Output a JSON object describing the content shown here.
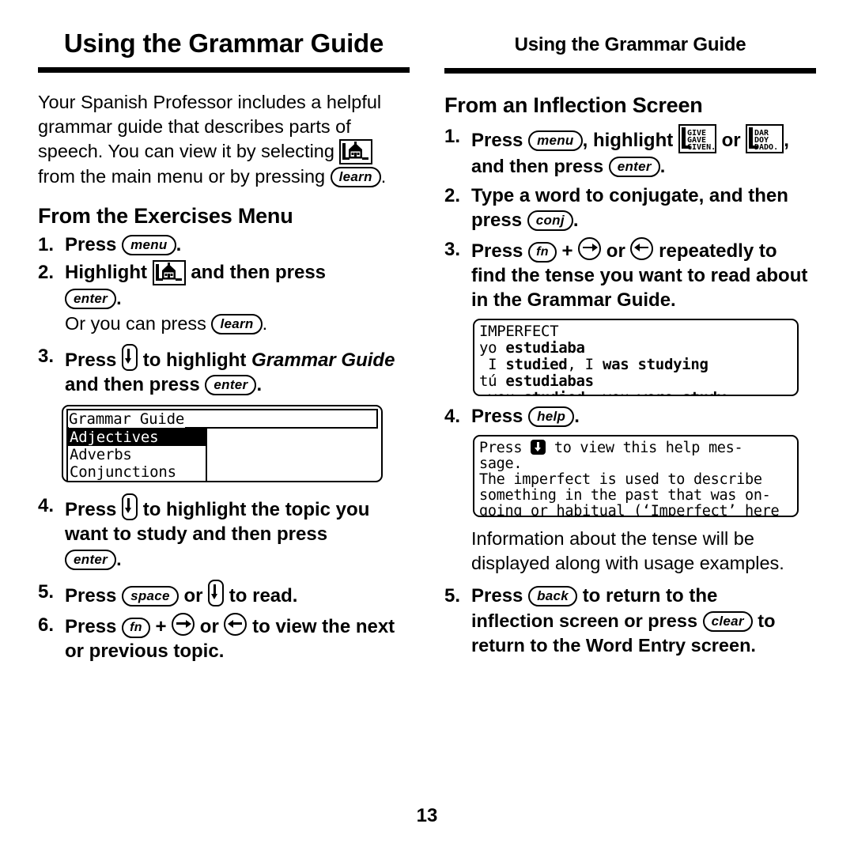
{
  "page": {
    "running_head_left": "Using the Grammar Guide",
    "running_head_right": "Using the Grammar Guide",
    "folio": "13"
  },
  "left_column": {
    "intro": {
      "text_1": "Your Spanish Professor includes a helpful grammar guide that describes parts of speech. You can view it by selecting",
      "text_2": "from the main menu or by pressing",
      "key_learn": "learn",
      "icon_school": "school-building-icon",
      "period": "."
    },
    "section_title": "From the Exercises Menu",
    "steps": [
      {
        "num": "1.",
        "pre": "Press",
        "key": "menu",
        "post": "."
      },
      {
        "num": "2.",
        "pre": "Highlight",
        "icon": "school-building-icon",
        "mid": "and then press",
        "key": "enter",
        "post": ".",
        "note_pre": "Or you can press",
        "note_key": "learn",
        "note_post": "."
      },
      {
        "num": "3.",
        "pre": "Press",
        "downkey": "down-arrow-key",
        "mid": "to highlight",
        "italic": "Grammar Guide",
        "mid2": "and then press",
        "key": "enter",
        "post": "."
      },
      {
        "num": "4.",
        "pre": "Press",
        "downkey": "down-arrow-key",
        "mid": "to highlight the topic you want to study and then press",
        "key": "enter",
        "post": "."
      },
      {
        "num": "5.",
        "pre": "Press",
        "key": "space",
        "mid": "or",
        "downkey": "down-arrow-key",
        "post": "to read."
      },
      {
        "num": "6.",
        "pre": "Press",
        "key": "fn",
        "plus": "+",
        "arrow_right": "right-arrow-key",
        "mid": "or",
        "arrow_left": "left-arrow-key",
        "post": "to view the next or previous topic."
      }
    ],
    "menu_screen": {
      "title": "Grammar Guide",
      "items": [
        {
          "label": "Adjectives",
          "selected": true
        },
        {
          "label": "Adverbs",
          "selected": false
        },
        {
          "label": "Conjunctions",
          "selected": false
        }
      ]
    }
  },
  "right_column": {
    "section_title": "From an Inflection Screen",
    "steps": [
      {
        "num": "1.",
        "pre": "Press",
        "key": "menu",
        "mid": ", highlight",
        "icon_1": "give-gave-given-icon",
        "or": "or",
        "icon_2": "dar-doy-dado-icon",
        "mid2": ", and then press",
        "key2": "enter",
        "post": "."
      },
      {
        "num": "2.",
        "pre": "Type a word to conjugate, and then press",
        "key": "conj",
        "post": "."
      },
      {
        "num": "3.",
        "pre": "Press",
        "key": "fn",
        "plus": "+",
        "arrow_right": "right-arrow-key",
        "mid": "or",
        "arrow_left": "left-arrow-key",
        "post": "repeatedly  to find the tense you want to read about in the Grammar Guide."
      },
      {
        "num": "4.",
        "pre": "Press",
        "key": "help",
        "post": "."
      },
      {
        "num": "5.",
        "pre": "Press",
        "key": "back",
        "mid": "to return to the inflection screen or press",
        "key2": "clear",
        "post": "to return to the Word Entry screen."
      }
    ],
    "note": "Information about the tense will be displayed along with usage examples.",
    "inflection_screen": {
      "lines": [
        {
          "plain_1": "IMPERFECT",
          "bold": "",
          "plain_2": ""
        },
        {
          "plain_1": "yo ",
          "bold": "estudiaba",
          "plain_2": ""
        },
        {
          "plain_1": " I ",
          "bold": "studied",
          "plain_2": ", I ",
          "bold_2": "was studying"
        },
        {
          "plain_1": "tú ",
          "bold": "estudiabas",
          "plain_2": ""
        },
        {
          "plain_1": " you ",
          "bold": "studied",
          "plain_2": ", you ",
          "bold_2": "were study–"
        }
      ]
    },
    "help_screen": {
      "line_1_pre": "Press ",
      "line_1_icon": "down-arrow-dot-icon",
      "line_1_post": " to view this help mes-",
      "line_2": "sage.",
      "line_3": "The imperfect is used to describe",
      "line_4": "something in the past that was on-",
      "line_5": "going or habitual (‘Imperfect’ here"
    }
  }
}
